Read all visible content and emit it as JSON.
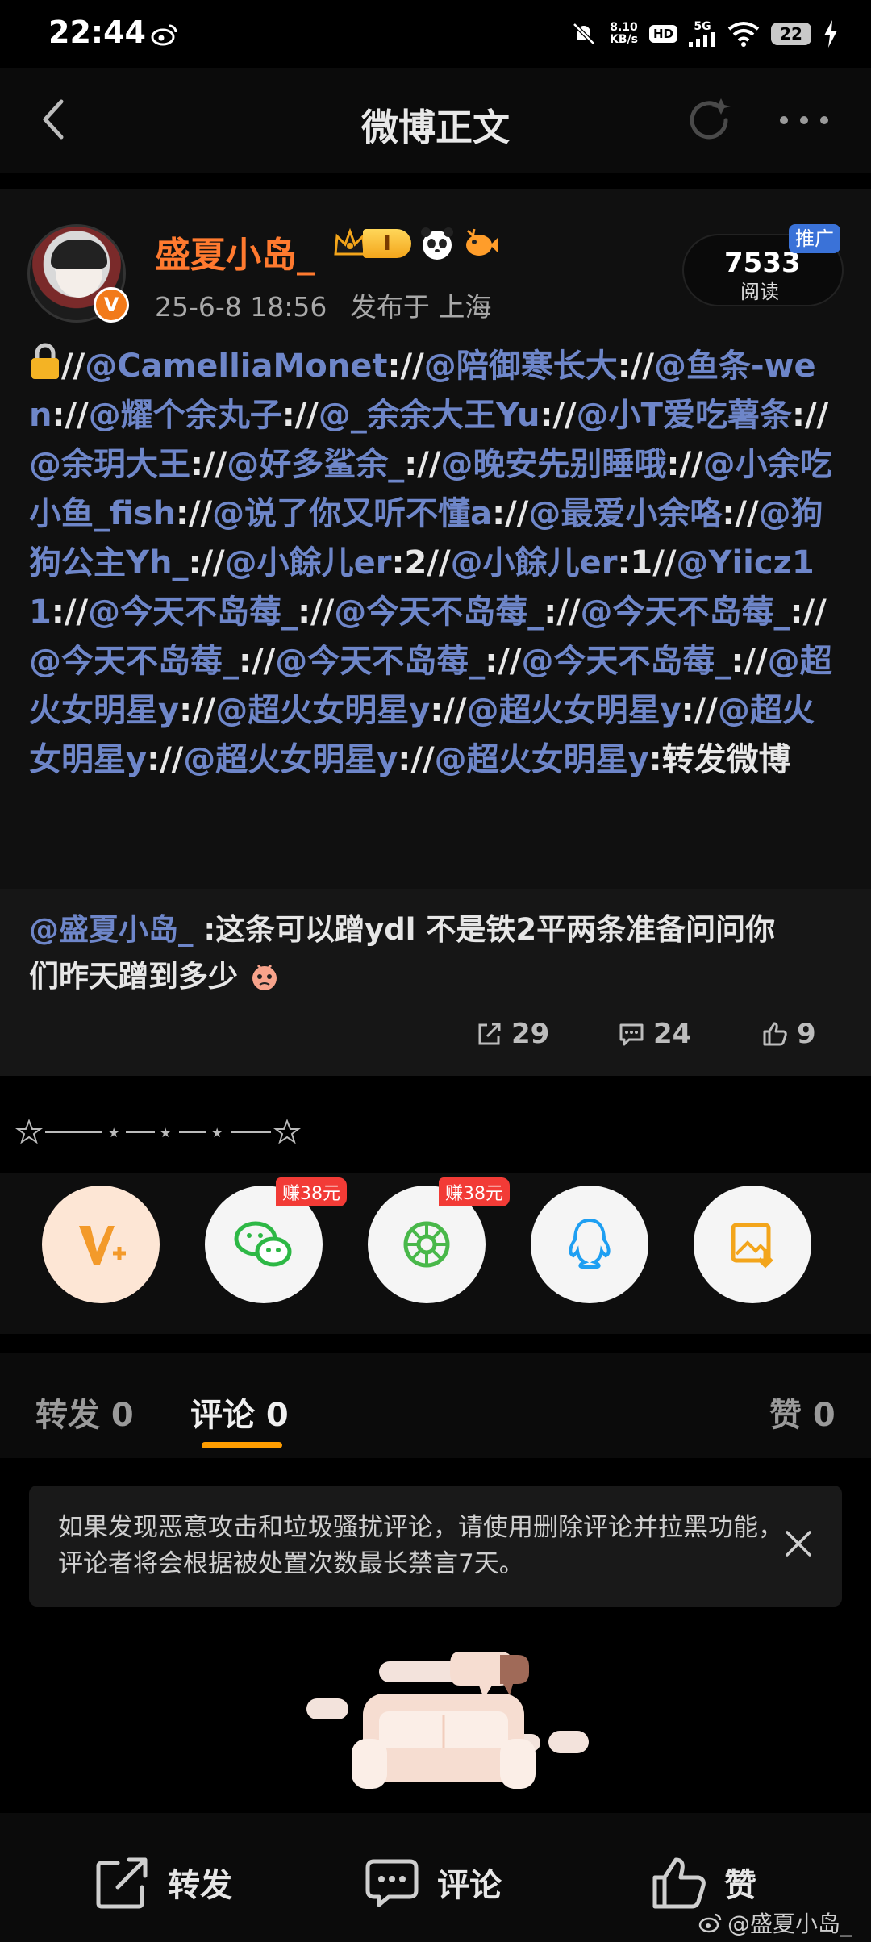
{
  "status_bar": {
    "time": "22:44",
    "net_speed_value": "8.10",
    "net_speed_unit": "KB/s",
    "hd_label": "HD",
    "network": "5G",
    "battery": "22",
    "icons": [
      "weibo-icon",
      "mute-icon",
      "signal-icon",
      "wifi-icon",
      "charging-icon"
    ]
  },
  "header": {
    "title": "微博正文",
    "icons": [
      "back-icon",
      "refresh-icon",
      "more-icon"
    ]
  },
  "post": {
    "author": "盛夏小岛_",
    "level_badge": "I",
    "date": "25-6-8 18:56",
    "location": "发布于 上海",
    "reads_count": "7533",
    "reads_label": "阅读",
    "promo_tag": "推广",
    "body_segments": [
      {
        "t": "//",
        "m": false
      },
      {
        "t": "@CamelliaMonet",
        "m": true
      },
      {
        "t": "://",
        "m": false
      },
      {
        "t": "@陪御寒长大",
        "m": true
      },
      {
        "t": "://",
        "m": false
      },
      {
        "t": "@鱼条-wen",
        "m": true
      },
      {
        "t": "://",
        "m": false
      },
      {
        "t": "@耀个余丸子",
        "m": true
      },
      {
        "t": "://",
        "m": false
      },
      {
        "t": "@_余余大王Yu",
        "m": true
      },
      {
        "t": "://",
        "m": false
      },
      {
        "t": "@小T爱吃薯条",
        "m": true
      },
      {
        "t": "://",
        "m": false
      },
      {
        "t": "@余玥大王",
        "m": true
      },
      {
        "t": "://",
        "m": false
      },
      {
        "t": "@好多鲨余_",
        "m": true
      },
      {
        "t": "://",
        "m": false
      },
      {
        "t": "@晚安先别睡哦",
        "m": true
      },
      {
        "t": "://",
        "m": false
      },
      {
        "t": "@小余吃小鱼_fish",
        "m": true
      },
      {
        "t": "://",
        "m": false
      },
      {
        "t": "@说了你又听不懂a",
        "m": true
      },
      {
        "t": "://",
        "m": false
      },
      {
        "t": "@最爱小余咯",
        "m": true
      },
      {
        "t": "://",
        "m": false
      },
      {
        "t": "@狗狗公主Yh_",
        "m": true
      },
      {
        "t": "://",
        "m": false
      },
      {
        "t": "@小餘儿er",
        "m": true
      },
      {
        "t": ":2//",
        "m": false
      },
      {
        "t": "@小餘儿er",
        "m": true
      },
      {
        "t": ":1//",
        "m": false
      },
      {
        "t": "@Yiicz11",
        "m": true
      },
      {
        "t": "://",
        "m": false
      },
      {
        "t": "@今天不岛莓_",
        "m": true
      },
      {
        "t": "://",
        "m": false
      },
      {
        "t": "@今天不岛莓_",
        "m": true
      },
      {
        "t": "://",
        "m": false
      },
      {
        "t": "@今天不岛莓_",
        "m": true
      },
      {
        "t": "://",
        "m": false
      },
      {
        "t": "@今天不岛莓_",
        "m": true
      },
      {
        "t": "://",
        "m": false
      },
      {
        "t": "@今天不岛莓_",
        "m": true
      },
      {
        "t": "://",
        "m": false
      },
      {
        "t": "@今天不岛莓_",
        "m": true
      },
      {
        "t": "://",
        "m": false
      },
      {
        "t": "@超火女明星y",
        "m": true
      },
      {
        "t": "://",
        "m": false
      },
      {
        "t": "@超火女明星y",
        "m": true
      },
      {
        "t": "://",
        "m": false
      },
      {
        "t": "@超火女明星y",
        "m": true
      },
      {
        "t": "://",
        "m": false
      },
      {
        "t": "@超火女明星y",
        "m": true
      },
      {
        "t": "://",
        "m": false
      },
      {
        "t": "@超火女明星y",
        "m": true
      },
      {
        "t": "://",
        "m": false
      },
      {
        "t": "@超火女明星y",
        "m": true
      },
      {
        "t": ":转发微博",
        "m": false
      }
    ],
    "quote_mention": "@盛夏小岛_",
    "quote_text": " :这条可以蹭ydl 不是铁2平两条准备问问你们昨天蹭到多少",
    "reposts": "29",
    "comments": "24",
    "likes": "9"
  },
  "share": {
    "earn_tag_1": "赚38元",
    "earn_tag_2": "赚38元",
    "items": [
      "vplus-icon",
      "wechat-icon",
      "moments-icon",
      "qq-icon",
      "save-image-icon"
    ]
  },
  "tabs": {
    "repost": "转发 0",
    "comment": "评论 0",
    "like": "赞 0"
  },
  "notice": {
    "text": "如果发现恶意攻击和垃圾骚扰评论，请使用删除评论并拉黑功能，评论者将会根据被处置次数最长禁言7天。"
  },
  "bottom_bar": {
    "repost": "转发",
    "comment": "评论",
    "like": "赞"
  },
  "watermark": "@盛夏小岛_",
  "colors": {
    "accent": "#ff9d00",
    "mention": "#6e86c9",
    "author": "#ff7a2f",
    "earn_tag": "#f23b36"
  }
}
